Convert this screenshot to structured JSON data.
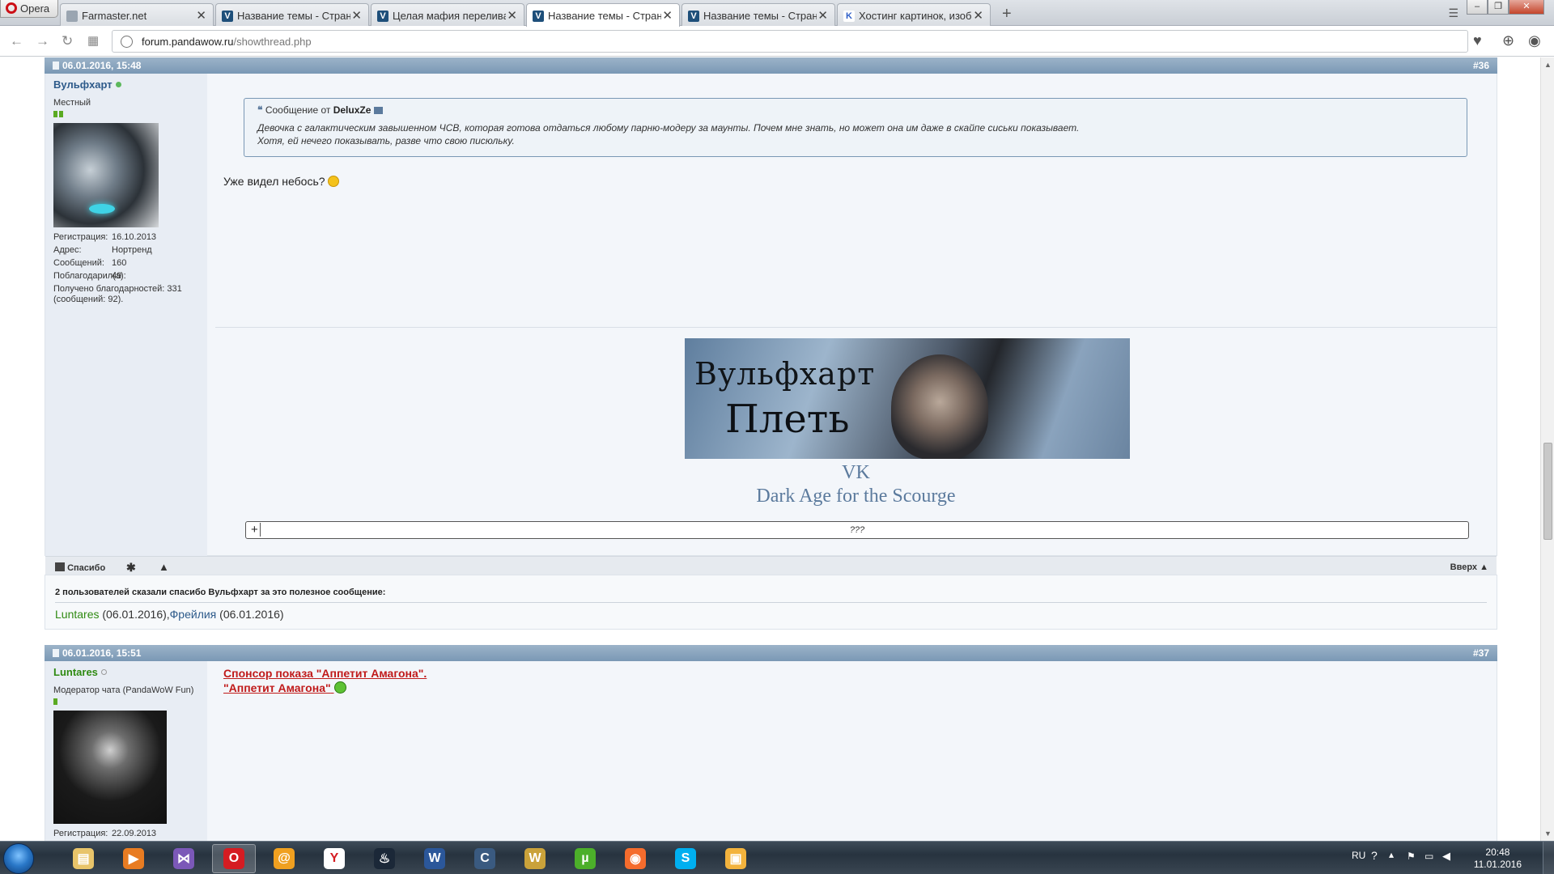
{
  "browser": {
    "menu_label": "Opera",
    "tabs": [
      {
        "title": "Farmaster.net",
        "icon": "farmaster-icon",
        "color": "#9aa5b1",
        "letter": ""
      },
      {
        "title": "Название темы - Страниц",
        "icon": "pandawow-icon",
        "color": "#1e4f7a",
        "letter": "V"
      },
      {
        "title": "Целая мафия перелива р",
        "icon": "pandawow-icon",
        "color": "#1e4f7a",
        "letter": "V"
      },
      {
        "title": "Название темы - Страниц",
        "icon": "pandawow-icon",
        "color": "#1e4f7a",
        "letter": "V",
        "active": true
      },
      {
        "title": "Название темы - Страниц",
        "icon": "pandawow-icon",
        "color": "#1e4f7a",
        "letter": "V"
      },
      {
        "title": "Хостинг картинок, изобр",
        "icon": "hosting-icon",
        "color": "#ffffff",
        "letter": "K"
      }
    ],
    "url_domain": "forum.pandawow.ru",
    "url_path": "/showthread.php"
  },
  "posts": [
    {
      "date": "06.01.2016, 15:48",
      "number": "#36",
      "username": "Вульфхарт",
      "user_title": "Местный",
      "stats": [
        {
          "label": "Регистрация:",
          "value": "16.10.2013"
        },
        {
          "label": "Адрес:",
          "value": "Нортренд"
        },
        {
          "label": "Сообщений:",
          "value": "160"
        },
        {
          "label": "Поблагодарил(а):",
          "value": "49"
        }
      ],
      "thanks_received": "Получено благодарностей: 331 (сообщений: 92).",
      "quote_prefix": "Сообщение от",
      "quote_author": "DeluxZe",
      "quote_line1": "Девочка с галактическим завышенном ЧСВ, которая готова отдаться любому парню-модеру за маунты. Почем мне знать, но может она им даже в скайпе сиськи показывает.",
      "quote_line2": "Хотя, ей нечего показывать, разве что свою писюльку.",
      "message": "Уже видел небось?",
      "banner_line1": "Вульфхарт",
      "banner_line2": "Плеть",
      "sig_link1": "VK",
      "sig_link2": "Dark Age for the Scourge",
      "spoiler_label": "???",
      "thanks_button": "Спасибо",
      "top_link": "Вверх ▲"
    },
    {
      "date": "06.01.2016, 15:51",
      "number": "#37",
      "username": "Luntares",
      "user_title": "Модератор чата (PandaWoW Fun)",
      "reg_label": "Регистрация:",
      "reg_value": "22.09.2013",
      "sponsor_line1": "Спонсор показа \"Аппетит Амагона\".",
      "sponsor_line2": "\"Аппетит Амагона\""
    }
  ],
  "thanks_box": {
    "title": "2 пользователей сказали спасибо Вульфхарт за это полезное сообщение:",
    "user1": "Luntares",
    "date1": " (06.01.2016),",
    "user2": "Фрейлия",
    "date2": " (06.01.2016)"
  },
  "taskbar": {
    "apps": [
      {
        "name": "explorer",
        "color": "#e8c46a",
        "glyph": "▤"
      },
      {
        "name": "media-player",
        "color": "#e87c22",
        "glyph": "▶"
      },
      {
        "name": "visual-studio",
        "color": "#7b58b8",
        "glyph": "⋈"
      },
      {
        "name": "opera",
        "color": "#d51c22",
        "glyph": "O",
        "active": true
      },
      {
        "name": "mail",
        "color": "#f0a020",
        "glyph": "@"
      },
      {
        "name": "yandex",
        "color": "#ffffff",
        "glyph": "Y"
      },
      {
        "name": "steam",
        "color": "#1b2838",
        "glyph": "♨"
      },
      {
        "name": "word",
        "color": "#2b579a",
        "glyph": "W"
      },
      {
        "name": "curse",
        "color": "#3a5a80",
        "glyph": "C"
      },
      {
        "name": "warcraft",
        "color": "#caa23a",
        "glyph": "W"
      },
      {
        "name": "utorrent",
        "color": "#4caf2a",
        "glyph": "µ"
      },
      {
        "name": "origin",
        "color": "#f56c2d",
        "glyph": "◉"
      },
      {
        "name": "skype",
        "color": "#00aff0",
        "glyph": "S"
      },
      {
        "name": "folder",
        "color": "#f3b33d",
        "glyph": "▣"
      }
    ],
    "language": "RU",
    "time": "20:48",
    "date": "11.01.2016"
  }
}
